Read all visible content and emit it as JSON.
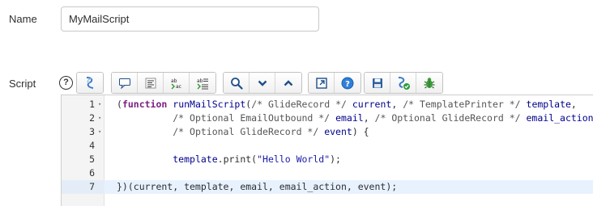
{
  "form": {
    "name_label": "Name",
    "name_value": "MyMailScript",
    "script_label": "Script",
    "help_glyph": "?"
  },
  "toolbar": {
    "groups": [
      [
        "script-debug-icon"
      ],
      [
        "comment-icon",
        "format-code-icon",
        "replace-icon",
        "replace-all-icon"
      ],
      [
        "search-icon",
        "chevron-down-icon",
        "chevron-up-icon"
      ],
      [
        "expand-icon",
        "help-icon"
      ],
      [
        "save-icon",
        "script-check-icon",
        "debug-icon"
      ]
    ]
  },
  "editor": {
    "active_line": 7,
    "lines": [
      {
        "n": "1",
        "fold": "▾",
        "tokens": [
          [
            "p",
            "("
          ],
          [
            "k",
            "function"
          ],
          [
            "p",
            " "
          ],
          [
            "f",
            "runMailScript"
          ],
          [
            "p",
            "("
          ],
          [
            "c",
            "/* GlideRecord */"
          ],
          [
            "p",
            " "
          ],
          [
            "f",
            "current"
          ],
          [
            "p",
            ", "
          ],
          [
            "c",
            "/* TemplatePrinter */"
          ],
          [
            "p",
            " "
          ],
          [
            "f",
            "template"
          ],
          [
            "p",
            ","
          ]
        ]
      },
      {
        "n": "2",
        "fold": "▾",
        "tokens": [
          [
            "p",
            "          "
          ],
          [
            "c",
            "/* Optional EmailOutbound */"
          ],
          [
            "p",
            " "
          ],
          [
            "f",
            "email"
          ],
          [
            "p",
            ", "
          ],
          [
            "c",
            "/* Optional GlideRecord */"
          ],
          [
            "p",
            " "
          ],
          [
            "f",
            "email_action"
          ],
          [
            "p",
            ","
          ]
        ]
      },
      {
        "n": "3",
        "fold": "▾",
        "tokens": [
          [
            "p",
            "          "
          ],
          [
            "c",
            "/* Optional GlideRecord */"
          ],
          [
            "p",
            " "
          ],
          [
            "f",
            "event"
          ],
          [
            "p",
            ") {"
          ]
        ]
      },
      {
        "n": "4",
        "fold": "",
        "tokens": []
      },
      {
        "n": "5",
        "fold": "",
        "tokens": [
          [
            "p",
            "          "
          ],
          [
            "f",
            "template"
          ],
          [
            "p",
            ".print("
          ],
          [
            "s",
            "\"Hello World\""
          ],
          [
            "p",
            ");"
          ]
        ]
      },
      {
        "n": "6",
        "fold": "",
        "tokens": []
      },
      {
        "n": "7",
        "fold": "",
        "tokens": [
          [
            "p",
            "})(current, template, email, email_action, event);"
          ]
        ]
      }
    ]
  },
  "colors": {
    "active_line_bg": "#e8f2ff",
    "keyword": "#7a1e7e",
    "identifier": "#00008b",
    "string": "#1a1aa6"
  }
}
